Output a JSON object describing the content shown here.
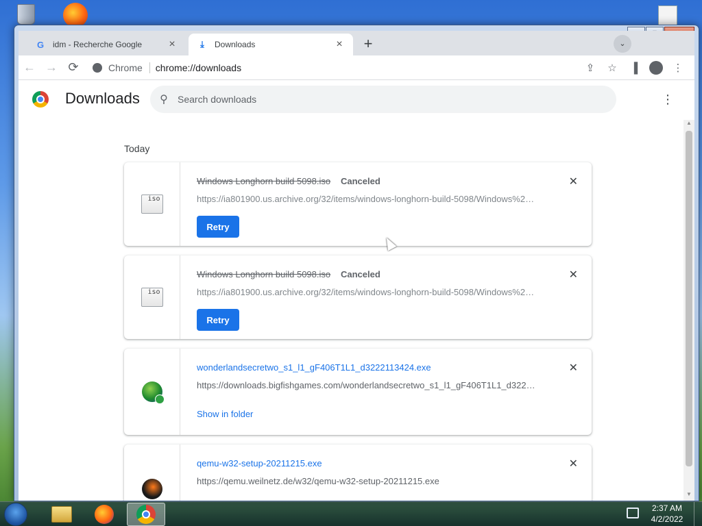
{
  "browser": {
    "tabs": [
      {
        "favicon": "G",
        "title": "idm - Recherche Google",
        "close": "×"
      },
      {
        "favicon": "⤓",
        "title": "Downloads",
        "close": "×"
      }
    ],
    "new_tab": "+",
    "tab_search": "⌄",
    "window_controls": {
      "minimize": "‒",
      "maximize": "▢",
      "close": "✕"
    },
    "toolbar": {
      "back": "←",
      "forward": "→",
      "reload": "⟳",
      "chip": "Chrome",
      "url": "chrome://downloads",
      "share": "⇪",
      "star": "☆",
      "sidepanel": "▐",
      "menu": "⋮"
    }
  },
  "downloads": {
    "title": "Downloads",
    "search_placeholder": "Search downloads",
    "menu": "⋮",
    "day": "Today",
    "items": [
      {
        "name": "Windows Longhorn build 5098.iso",
        "status": "Canceled",
        "url": "https://ia801900.us.archive.org/32/items/windows-longhorn-build-5098/Windows%2…",
        "action": "Retry",
        "icon": "iso-file-icon",
        "icon_label": "iso"
      },
      {
        "name": "Windows Longhorn build 5098.iso",
        "status": "Canceled",
        "url": "https://ia801900.us.archive.org/32/items/windows-longhorn-build-5098/Windows%2…",
        "action": "Retry",
        "icon": "iso-file-icon",
        "icon_label": "iso"
      },
      {
        "name": "wonderlandsecretwo_s1_l1_gF406T1L1_d3222113424.exe",
        "url": "https://downloads.bigfishgames.com/wonderlandsecretwo_s1_l1_gF406T1L1_d322…",
        "action": "Show in folder",
        "icon": "game-installer-icon"
      },
      {
        "name": "qemu-w32-setup-20211215.exe",
        "url": "https://qemu.weilnetz.de/w32/qemu-w32-setup-20211215.exe",
        "icon": "qemu-icon"
      }
    ],
    "close_glyph": "✕"
  },
  "taskbar": {
    "time": "2:37 AM",
    "date": "4/2/2022"
  }
}
